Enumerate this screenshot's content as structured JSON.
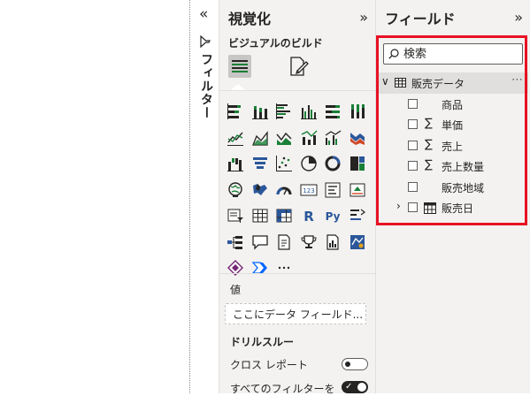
{
  "filters": {
    "collapse_glyph": "«",
    "label": "フィルター"
  },
  "visualizations": {
    "title": "視覚化",
    "expand_glyph": "»",
    "subtitle": "ビジュアルのビルド",
    "more_glyph": "⋯",
    "values_label": "値",
    "values_placeholder": "ここにデータ フィールド...",
    "drill_title": "ドリルスルー",
    "cross_report_label": "クロス レポート",
    "cross_report_state": "off",
    "all_filters_label": "すべてのフィルターを",
    "all_filters_state": "on",
    "icons": [
      "stacked-bar-chart-icon",
      "stacked-column-chart-icon",
      "clustered-bar-chart-icon",
      "clustered-column-chart-icon",
      "100-percent-stacked-bar-icon",
      "100-percent-stacked-column-icon",
      "line-chart-icon",
      "area-chart-icon",
      "stacked-area-chart-icon",
      "line-stacked-column-icon",
      "line-clustered-column-icon",
      "ribbon-chart-icon",
      "waterfall-chart-icon",
      "funnel-chart-icon",
      "scatter-chart-icon",
      "pie-chart-icon",
      "donut-chart-icon",
      "treemap-icon",
      "map-icon",
      "filled-map-icon",
      "gauge-icon",
      "card-icon",
      "multi-row-card-icon",
      "kpi-icon",
      "slicer-icon",
      "table-icon",
      "matrix-icon",
      "r-script-visual-icon",
      "python-visual-icon",
      "key-influencers-icon",
      "decomposition-tree-icon",
      "qa-icon",
      "smart-narrative-icon",
      "metrics-icon",
      "paginated-report-icon",
      "azure-map-icon",
      "power-apps-icon",
      "power-automate-icon",
      "more-visuals-icon"
    ],
    "icon_texts": {
      "card": "123",
      "r": "R",
      "py": "Py"
    }
  },
  "fields": {
    "title": "フィールド",
    "expand_glyph": "»",
    "search_placeholder": "検索",
    "table": {
      "name": "販売データ",
      "expanded_glyph": "∨",
      "more_glyph": "⋯",
      "items": [
        {
          "name": "商品",
          "sigma": ""
        },
        {
          "name": "単価",
          "sigma": "∑"
        },
        {
          "name": "売上",
          "sigma": "∑"
        },
        {
          "name": "売上数量",
          "sigma": "∑"
        },
        {
          "name": "販売地域",
          "sigma": ""
        },
        {
          "name": "販売日",
          "sigma": "",
          "expander": "›",
          "calendar": true
        }
      ]
    },
    "highlight_color": "#e81123"
  }
}
